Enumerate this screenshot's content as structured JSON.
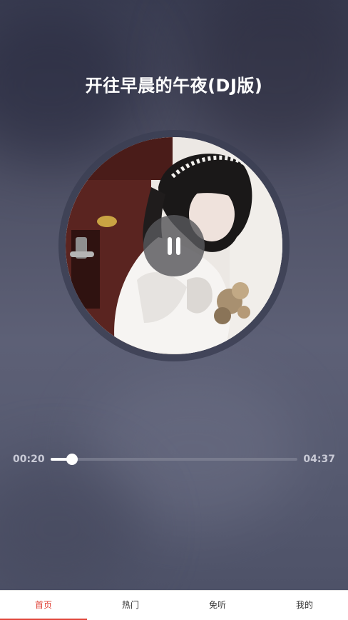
{
  "player": {
    "title": "开往早晨的午夜(DJ版)",
    "current_time": "00:20",
    "duration": "04:37",
    "progress_fraction": 0.087,
    "state_icon": "pause-icon"
  },
  "tabs": [
    {
      "label": "首页",
      "active": true
    },
    {
      "label": "热门",
      "active": false
    },
    {
      "label": "免听",
      "active": false
    },
    {
      "label": "我的",
      "active": false
    }
  ],
  "colors": {
    "accent": "#e0453a",
    "title": "#ffffff",
    "time_text": "#c9cad6"
  }
}
